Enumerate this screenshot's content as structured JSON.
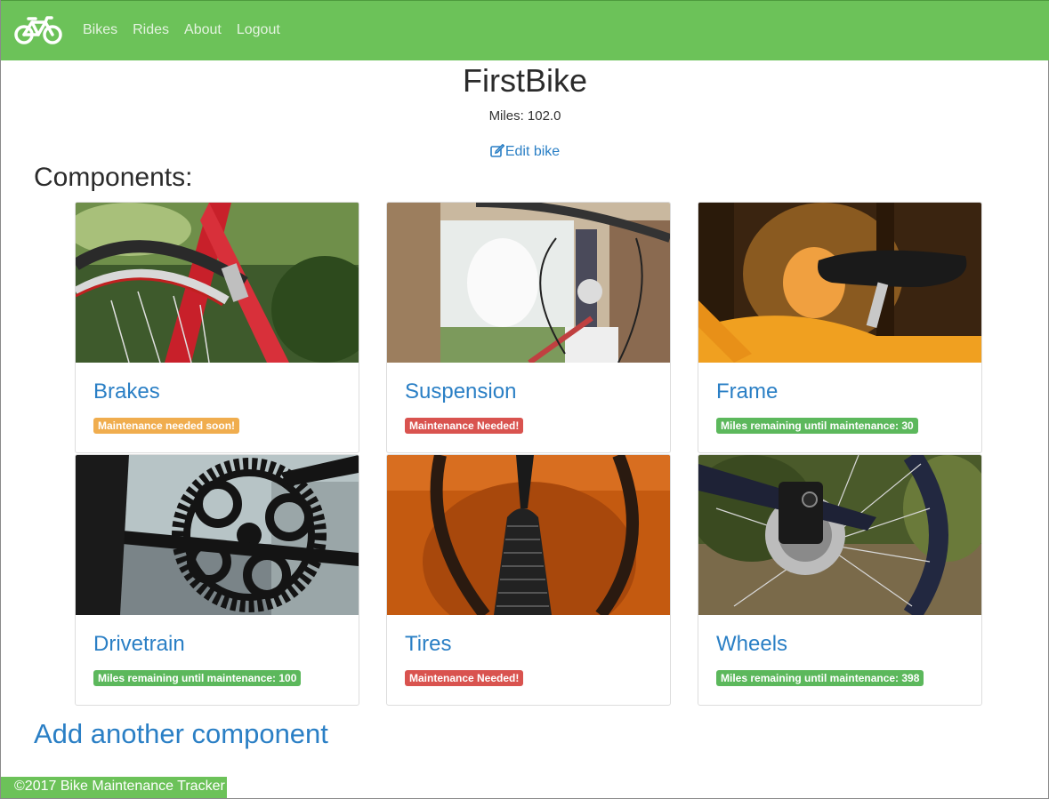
{
  "nav": {
    "brand_icon": "bicycle-icon",
    "links": [
      "Bikes",
      "Rides",
      "About",
      "Logout"
    ]
  },
  "bike": {
    "name": "FirstBike",
    "miles_text": "Miles: 102.0",
    "edit_label": "Edit bike",
    "edit_icon": "edit-icon"
  },
  "components_heading": "Components:",
  "components": [
    {
      "name": "Brakes",
      "status": "Maintenance needed soon!",
      "status_color": "#f0ad4e"
    },
    {
      "name": "Suspension",
      "status": "Maintenance Needed!",
      "status_color": "#d9534f"
    },
    {
      "name": "Frame",
      "status": "Miles remaining until maintenance: 30",
      "status_color": "#5cb85c"
    },
    {
      "name": "Drivetrain",
      "status": "Miles remaining until maintenance: 100",
      "status_color": "#5cb85c"
    },
    {
      "name": "Tires",
      "status": "Maintenance Needed!",
      "status_color": "#d9534f"
    },
    {
      "name": "Wheels",
      "status": "Miles remaining until maintenance: 398",
      "status_color": "#5cb85c"
    }
  ],
  "add_component_label": "Add another component",
  "footer": "©2017 Bike Maintenance Tracker",
  "colors": {
    "navbar": "#6cc259",
    "link": "#2a7fc5"
  }
}
